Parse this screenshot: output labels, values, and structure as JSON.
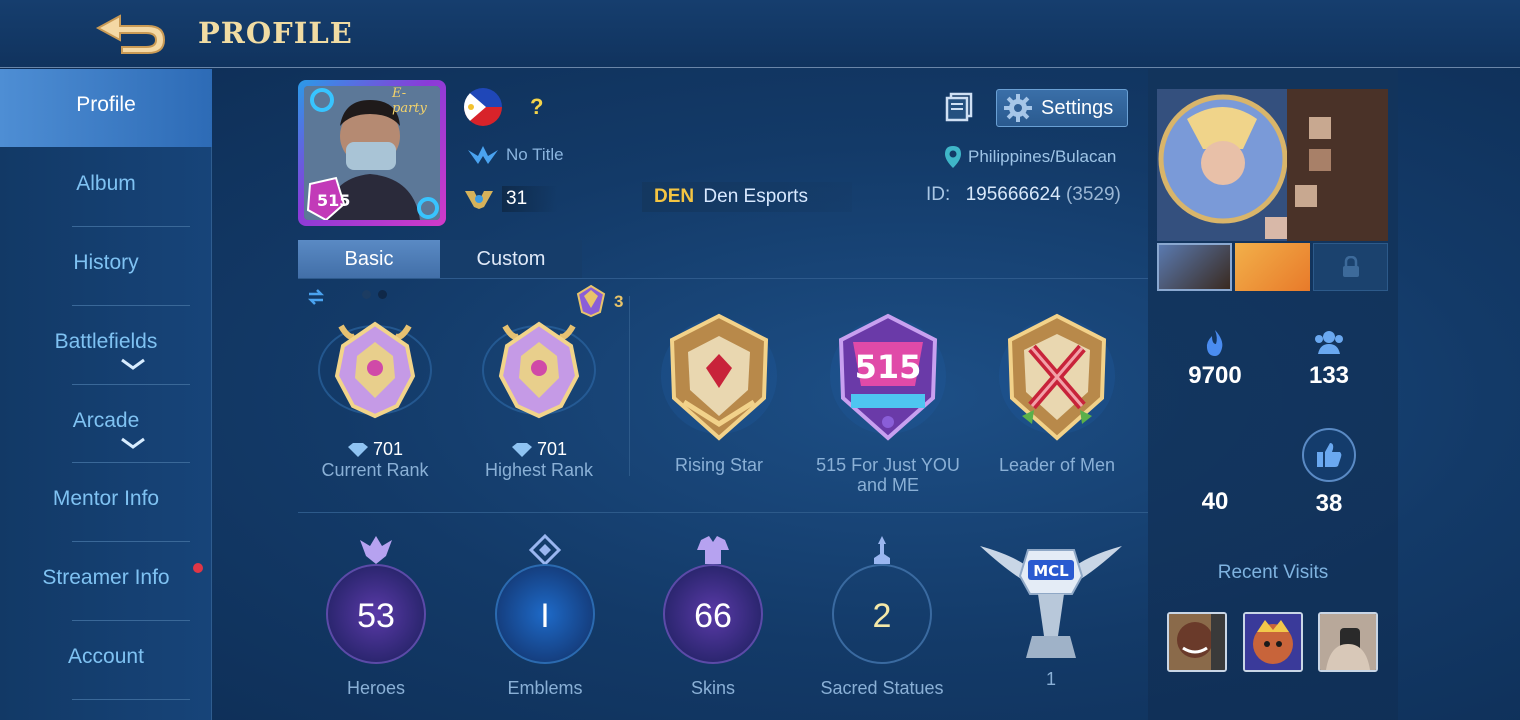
{
  "header": {
    "title": "PROFILE"
  },
  "sidebar": {
    "items": [
      {
        "label": "Profile"
      },
      {
        "label": "Album"
      },
      {
        "label": "History"
      },
      {
        "label": "Battlefields"
      },
      {
        "label": "Arcade"
      },
      {
        "label": "Mentor Info"
      },
      {
        "label": "Streamer Info"
      },
      {
        "label": "Account"
      }
    ]
  },
  "profile": {
    "frame_text": "E-party",
    "question_mark": "?",
    "title": "No Title",
    "level": "31",
    "squad_tag": "DEN",
    "squad_name": "Den Esports",
    "settings_label": "Settings",
    "location": "Philippines/Bulacan",
    "id_label": "ID:",
    "id_value": "195666624",
    "id_server": "(3529)"
  },
  "tabs": [
    {
      "label": "Basic"
    },
    {
      "label": "Custom"
    }
  ],
  "medals": [
    {
      "name": "Current Rank",
      "points": "701"
    },
    {
      "name": "Highest Rank",
      "points": "701"
    },
    {
      "name": "Rising Star"
    },
    {
      "name": "515 For Just YOU and ME"
    },
    {
      "name": "Leader of Men"
    }
  ],
  "season_badge_count": "3",
  "stats": [
    {
      "label": "Heroes",
      "value": "53",
      "icon": "heroes-icon"
    },
    {
      "label": "Emblems",
      "value": "I",
      "icon": "emblems-icon"
    },
    {
      "label": "Skins",
      "value": "66",
      "icon": "skins-icon"
    },
    {
      "label": "Sacred Statues",
      "value": "2",
      "icon": "statue-icon"
    }
  ],
  "mcl": {
    "badge_text": "MCL",
    "count": "1"
  },
  "right": {
    "popularity": "9700",
    "followers": "133",
    "stat_a": "40",
    "likes": "38",
    "recent_label": "Recent Visits"
  },
  "colors": {
    "accent_gold": "#f1dca3",
    "active_tab": "#4e8ed4",
    "notification": "#e03646"
  }
}
